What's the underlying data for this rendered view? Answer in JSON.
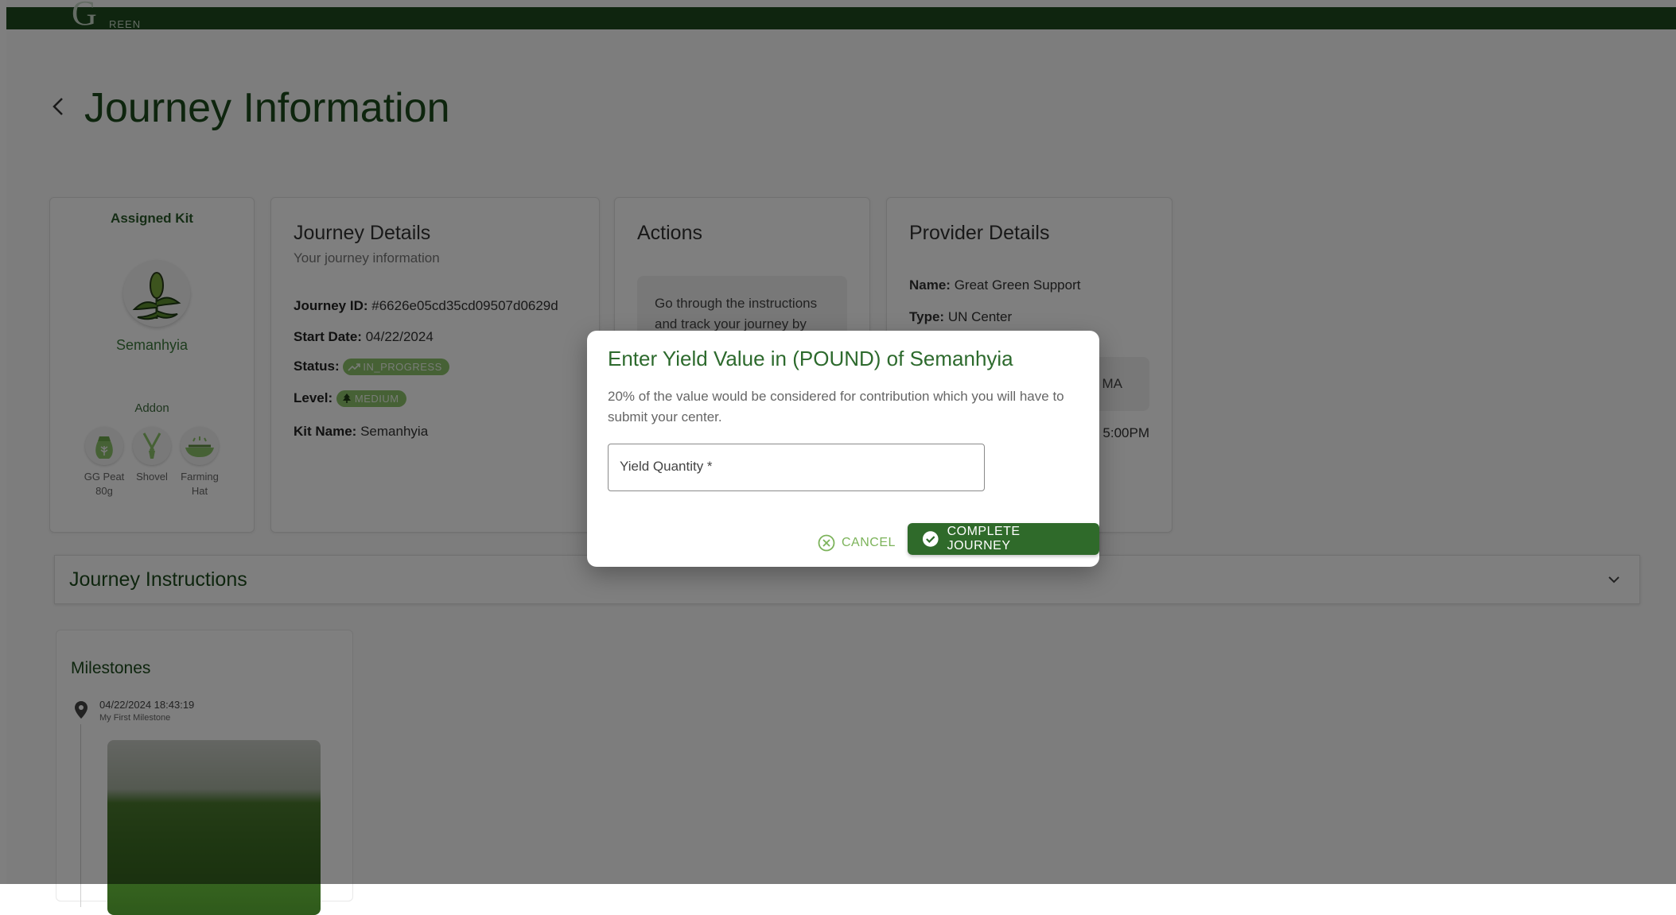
{
  "app": {
    "logo_mark": "G",
    "logo_text": "REEN"
  },
  "page": {
    "title": "Journey Information"
  },
  "kit": {
    "title": "Assigned Kit",
    "name": "Semanhyia",
    "addon_title": "Addon",
    "addons": [
      {
        "label": "GG Peat 80g",
        "icon": "seed-bag-icon"
      },
      {
        "label": "Shovel",
        "icon": "shovel-icon"
      },
      {
        "label": "Farming Hat",
        "icon": "farming-hat-icon"
      }
    ]
  },
  "journey_details": {
    "title": "Journey Details",
    "subtitle": "Your journey information",
    "id_label": "Journey ID:",
    "id_value": "#6626e05cd35cd09507d0629d",
    "start_label": "Start Date:",
    "start_value": "04/22/2024",
    "status_label": "Status:",
    "status_value": "IN_PROGRESS",
    "level_label": "Level:",
    "level_value": "MEDIUM",
    "kit_label": "Kit Name:",
    "kit_value": "Semanhyia"
  },
  "actions": {
    "title": "Actions",
    "text": "Go through the instructions and track your journey by"
  },
  "provider": {
    "title": "Provider Details",
    "name_label": "Name:",
    "name_value": "Great Green Support",
    "type_label": "Type:",
    "type_value": "UN Center",
    "box_text": "MA",
    "time_text": "5:00PM"
  },
  "instructions": {
    "title": "Journey Instructions"
  },
  "milestones": {
    "title": "Milestones",
    "items": [
      {
        "date": "04/22/2024 18:43:19",
        "name": "My First Milestone"
      }
    ]
  },
  "dialog": {
    "title": "Enter Yield Value in (POUND) of Semanhyia",
    "text": "20% of the value would be considered for contribution which you will have to submit your center.",
    "field_label": "Yield Quantity *",
    "field_value": "",
    "cancel_label": "CANCEL",
    "complete_label": "COMPLETE JOURNEY"
  },
  "colors": {
    "brand_dark": "#1f4a1f",
    "primary_button": "#2f6a2a",
    "accent_light": "#7cb35a",
    "chip": "#8cc26a"
  }
}
